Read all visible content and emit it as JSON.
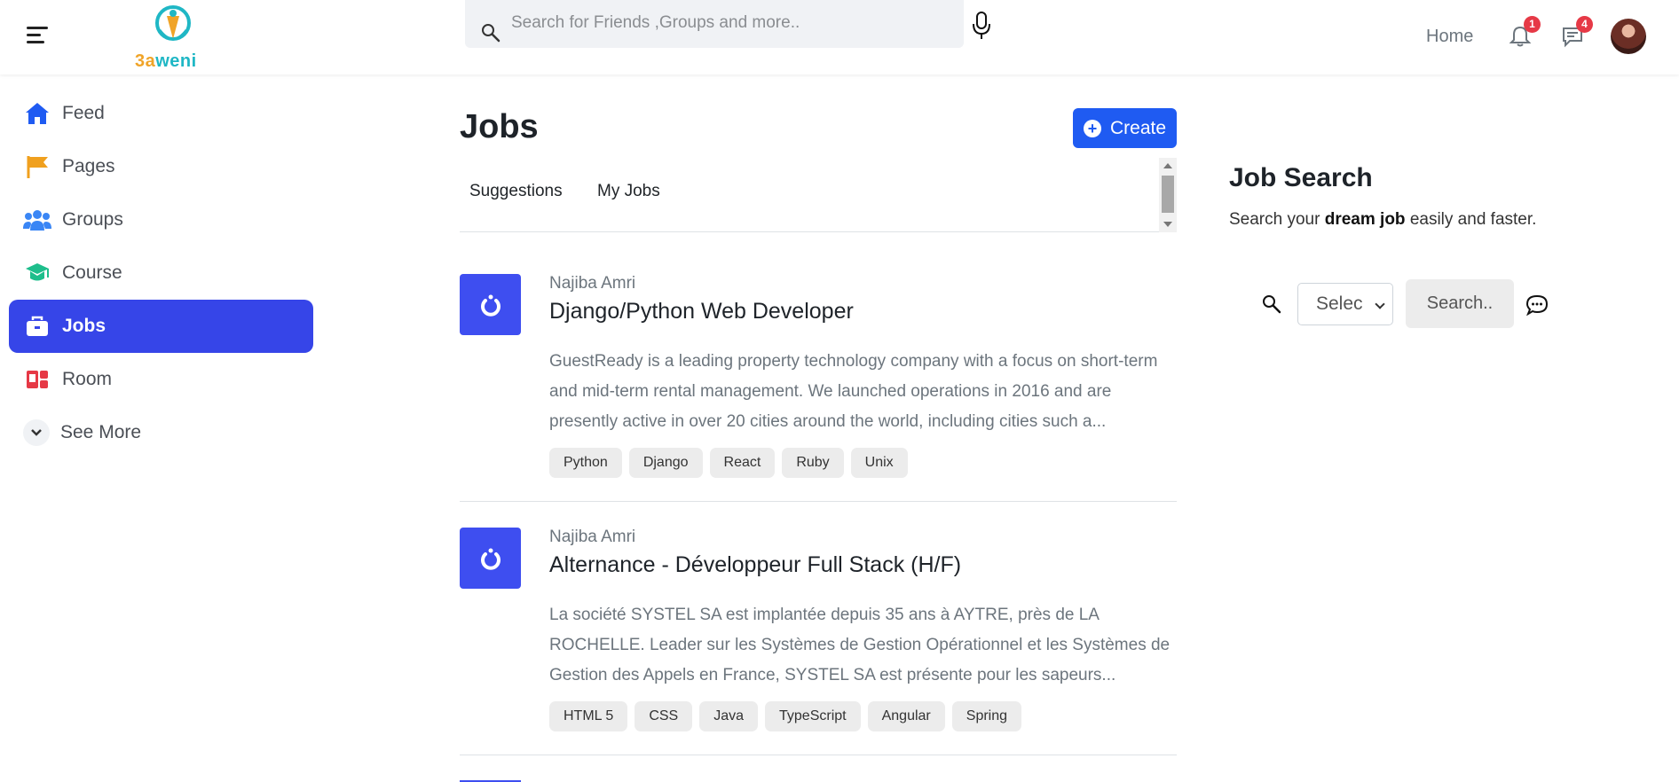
{
  "header": {
    "logo_text_part1": "3a",
    "logo_text_part2": "weni",
    "search_placeholder": "Search for Friends ,Groups and more..",
    "home_label": "Home",
    "notifications_count": "1",
    "messages_count": "4"
  },
  "sidebar": {
    "items": [
      {
        "label": "Feed",
        "icon": "home-icon",
        "color": "#1f5bf2"
      },
      {
        "label": "Pages",
        "icon": "flag-icon",
        "color": "#f0a01e"
      },
      {
        "label": "Groups",
        "icon": "users-icon",
        "color": "#3a86f5"
      },
      {
        "label": "Course",
        "icon": "graduation-cap-icon",
        "color": "#1ebe8c"
      },
      {
        "label": "Jobs",
        "icon": "briefcase-icon",
        "color": "#ffffff"
      },
      {
        "label": "Room",
        "icon": "room-icon",
        "color": "#e63946"
      }
    ],
    "see_more": "See More"
  },
  "main": {
    "title": "Jobs",
    "create_label": "Create",
    "tabs": [
      "Suggestions",
      "My Jobs"
    ],
    "jobs": [
      {
        "author": "Najiba Amri",
        "title": "Django/Python Web Developer",
        "description": "GuestReady is a leading property technology company with a focus on short-term and mid-term rental management. We launched operations in 2016 and are presently active in over 20 cities around the world, including cities such a...",
        "tags": [
          "Python",
          "Django",
          "React",
          "Ruby",
          "Unix"
        ]
      },
      {
        "author": "Najiba Amri",
        "title": "Alternance - Développeur Full Stack (H/F)",
        "description": "La société SYSTEL SA est implantée depuis 35 ans à AYTRE, près de LA ROCHELLE. Leader sur les Systèmes de Gestion Opérationnel et les Systèmes de Gestion des Appels en France, SYSTEL SA est présente pour les sapeurs...",
        "tags": [
          "HTML 5",
          "CSS",
          "Java",
          "TypeScript",
          "Angular",
          "Spring"
        ]
      }
    ]
  },
  "right": {
    "title": "Job Search",
    "subtitle_pre": "Search your ",
    "subtitle_bold": "dream job",
    "subtitle_post": " easily and faster.",
    "select_value": "Selec",
    "search_button": "Search.."
  }
}
